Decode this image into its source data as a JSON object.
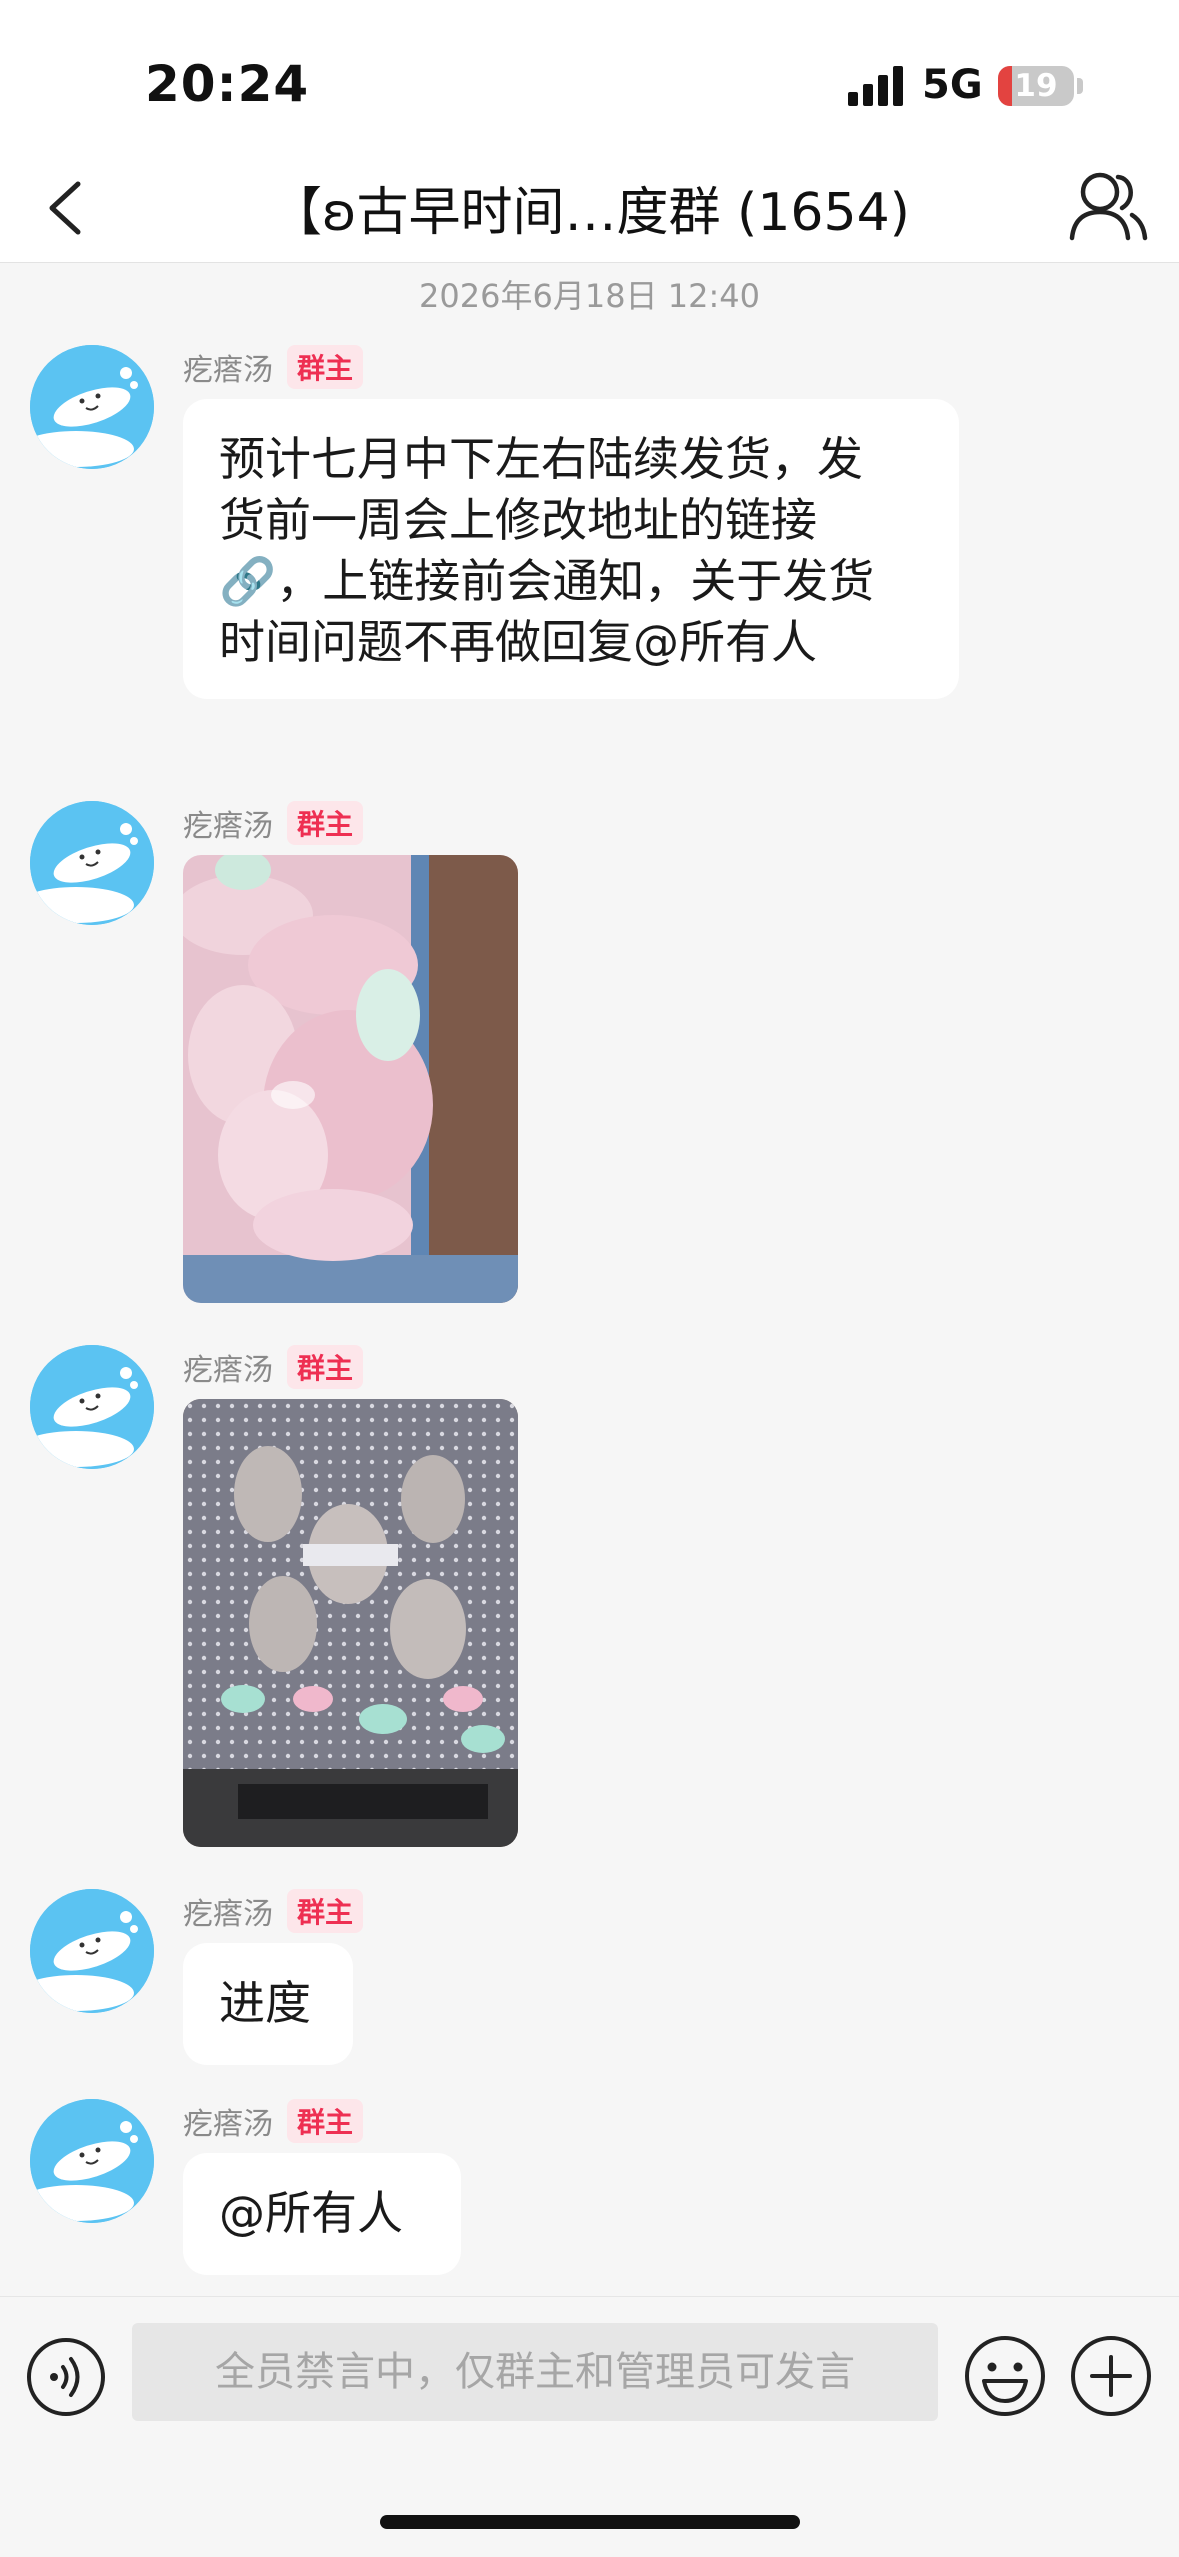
{
  "status_bar": {
    "time": "20:24",
    "network": "5G",
    "battery_level": "19",
    "battery_fraction": 0.19,
    "battery_color": "#e34340"
  },
  "nav": {
    "back_icon": "chevron-left-icon",
    "title": "【ʚ古早时间…度群 (1654)",
    "members_icon": "group-members-icon"
  },
  "chat": {
    "timestamp": "2026年6月18日 12:40",
    "badge_color": "#ee2f52",
    "messages": [
      {
        "sender": "疙瘩汤",
        "badge": "群主",
        "type": "text",
        "lines": [
          "预计七月中下左右陆续发货，发",
          "货前一周会上修改地址的链接",
          "🔗，上链接前会通知，关于发货",
          "时间问题不再做回复@所有人"
        ]
      },
      {
        "sender": "疙瘩汤",
        "badge": "群主",
        "type": "image",
        "image": "pink-fabric-photo"
      },
      {
        "sender": "疙瘩汤",
        "badge": "群主",
        "type": "image",
        "image": "gray-polka-dot-fabric-photo"
      },
      {
        "sender": "疙瘩汤",
        "badge": "群主",
        "type": "text",
        "lines": [
          "进度"
        ]
      },
      {
        "sender": "疙瘩汤",
        "badge": "群主",
        "type": "text",
        "lines": [
          "@所有人"
        ]
      }
    ]
  },
  "input_bar": {
    "voice_icon": "voice-icon",
    "placeholder": "全员禁言中，仅群主和管理员可发言",
    "emoji_icon": "emoji-icon",
    "plus_icon": "plus-icon"
  }
}
